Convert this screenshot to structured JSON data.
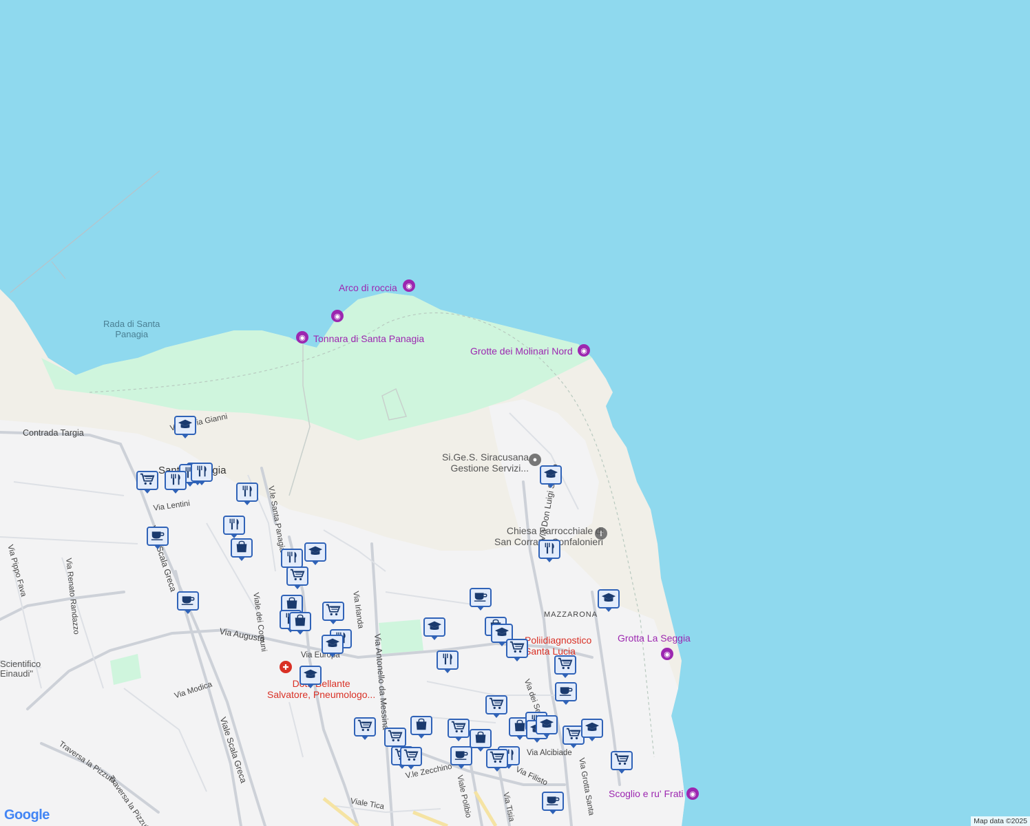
{
  "map": {
    "colors": {
      "water": "#8fd9ee",
      "land": "#f1efe8",
      "urban": "#f3f3f4",
      "park": "#cff5dd",
      "road": "#cdd1d8",
      "pin_fill": "#e3ecfb",
      "pin_border": "#2f62b7",
      "icon": "#1a3a6e"
    },
    "poi_labels": [
      {
        "text": "Arco di roccia",
        "kind": "purple"
      },
      {
        "text": "Tonnara di Santa Panagia",
        "kind": "purple"
      },
      {
        "text": "Grotte dei Molinari Nord",
        "kind": "purple"
      },
      {
        "text": "Grotta La Seggia",
        "kind": "purple"
      },
      {
        "text": "Scoglio e ru' Frati",
        "kind": "purple"
      },
      {
        "text": "Si.Ge.S. Siracusana",
        "kind": "gray"
      },
      {
        "text": "Gestione Servizi...",
        "kind": "gray"
      },
      {
        "text": "Chiesa Parrocchiale di",
        "kind": "gray"
      },
      {
        "text": "San Corrado Confalonieri",
        "kind": "gray"
      },
      {
        "text": "Poliidiagnostico",
        "kind": "red"
      },
      {
        "text": "Santa Lucia",
        "kind": "red"
      },
      {
        "text": "Dott. Bellante",
        "kind": "red"
      },
      {
        "text": "Salvatore, Pneumologo...",
        "kind": "red"
      }
    ],
    "water_labels": [
      "Rada di Santa",
      "Panagia"
    ],
    "area_labels": [
      "MAZZARONA",
      "Santa Panagia",
      "Scientifico",
      "Einaudi\""
    ],
    "streets": [
      "Contrada Targia",
      "Via Maria Gianni",
      "Via Lentini",
      "V.le Santa Panagia",
      "Viale Scala Greca",
      "Viale dei Comuni",
      "Via Augusta",
      "Via Irlanda",
      "Via Antonello da Messina",
      "Via Don Luigi Sturzo",
      "Via dei Servi",
      "Via Filisto",
      "Via Renato Randazzo",
      "Via Pippo Fava",
      "Via Modica",
      "Traversa la Pizzuta",
      "Via Europa",
      "V.le Zecchino",
      "Viale Polibio",
      "Viale Tica",
      "Via Tisia",
      "Via Grotta Santa",
      "Via Alcibiade",
      "Via Ela"
    ],
    "pin_icons": [
      "school-icon",
      "restaurant-icon",
      "cart-icon",
      "cafe-icon",
      "shopping-bag-icon"
    ],
    "attribution": "Map data ©2025",
    "logo": "Google"
  }
}
